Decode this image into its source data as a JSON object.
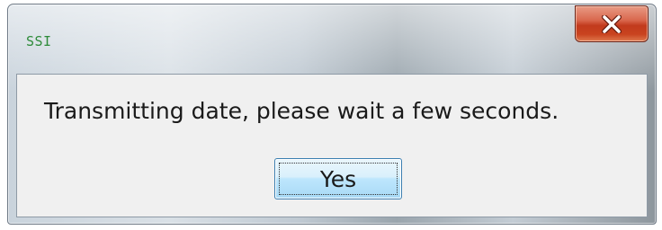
{
  "dialog": {
    "title": "SSI",
    "message": "Transmitting date, please wait a few seconds.",
    "yes_label": "Yes",
    "close_icon": "close-icon"
  },
  "colors": {
    "title_text": "#2e8b3a",
    "close_button": "#c23a1d",
    "button_accent": "#3c7fb1",
    "content_background": "#f0f0f0"
  }
}
